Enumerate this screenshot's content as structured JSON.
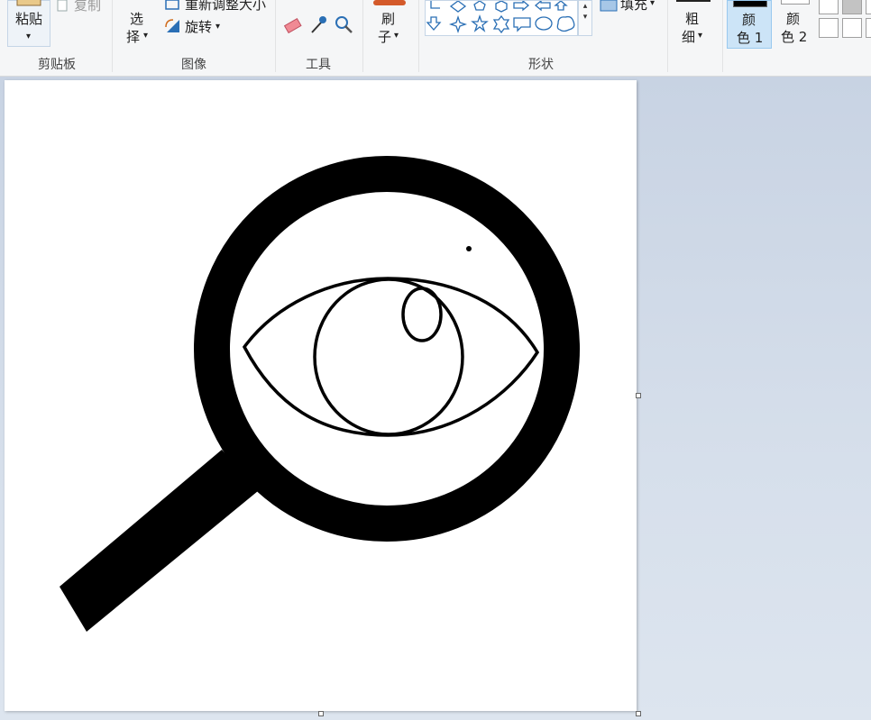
{
  "ribbon": {
    "clipboard": {
      "paste_label": "粘贴",
      "copy_label": "复制",
      "group_label": "剪贴板"
    },
    "image": {
      "select_label_1": "选",
      "select_label_2": "择",
      "resize_label": "重新调整大小",
      "rotate_label": "旋转",
      "group_label": "图像"
    },
    "tools": {
      "group_label": "工具"
    },
    "brushes": {
      "label_1": "刷",
      "label_2": "子"
    },
    "shapes": {
      "fill_label": "填充",
      "group_label": "形状"
    },
    "size": {
      "label_1": "粗",
      "label_2": "细"
    },
    "colors": {
      "color1_label_1": "颜",
      "color1_label_2": "色 1",
      "color2_label_1": "颜",
      "color2_label_2": "色 2"
    }
  },
  "colors": {
    "ink": "#000000",
    "accent": "#cce4f7",
    "workspace": "#c8d3e3"
  }
}
